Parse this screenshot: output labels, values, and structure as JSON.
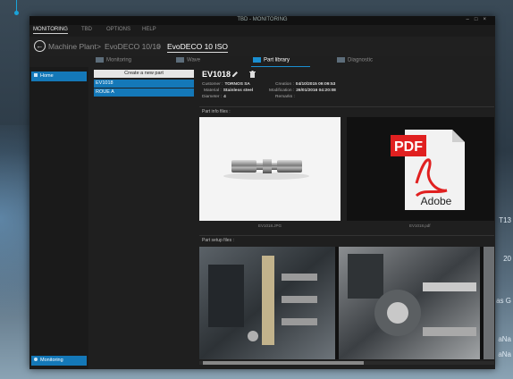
{
  "window": {
    "title": "TBD - MONITORING",
    "controls": [
      "–",
      "□",
      "×"
    ]
  },
  "menu": [
    "MONITORING",
    "TBD",
    "OPTIONS",
    "HELP"
  ],
  "breadcrumb": {
    "items": [
      "Machine Plant",
      ">",
      "EvoDECO 10/10",
      ">"
    ],
    "current": "EvoDECO 10 ISO"
  },
  "tabs": [
    {
      "label": "Monitoring",
      "icon": "monitoring-icon"
    },
    {
      "label": "Wave",
      "icon": "wave-icon"
    },
    {
      "label": "Part library",
      "icon": "library-icon",
      "active": true
    },
    {
      "label": "Diagnostic",
      "icon": "diagnostic-icon"
    }
  ],
  "sidebar": {
    "items": [
      {
        "label": "Home",
        "icon": "home-icon"
      }
    ],
    "bottom_button": "Monitoring"
  },
  "parts": {
    "create_label": "Create a new part",
    "items": [
      "EV1018",
      "ROUE A"
    ]
  },
  "detail": {
    "part_name": "EV1018",
    "fields_left": [
      {
        "label": "Customer :",
        "value": "TORNOS SA"
      },
      {
        "label": "Material :",
        "value": "Stainless steel"
      },
      {
        "label": "Diameter :",
        "value": "4"
      }
    ],
    "fields_right": [
      {
        "label": "Creation :",
        "value": "04/10/2015 09:09:53"
      },
      {
        "label": "Modification :",
        "value": "26/01/2016 04:20:08"
      },
      {
        "label": "Remarks :",
        "value": ""
      }
    ],
    "info_files_label": "Part info files :",
    "setup_files_label": "Part setup files :",
    "file_captions": [
      "EV1018.JPG",
      "EV1018.pdf"
    ]
  },
  "pdf_badge": "PDF",
  "adobe_text": "Adobe",
  "background_text": [
    "T13",
    "20",
    "as G",
    "aNa",
    "aNa"
  ],
  "colors": {
    "accent": "#1478b8",
    "pdf_red": "#e02020"
  }
}
